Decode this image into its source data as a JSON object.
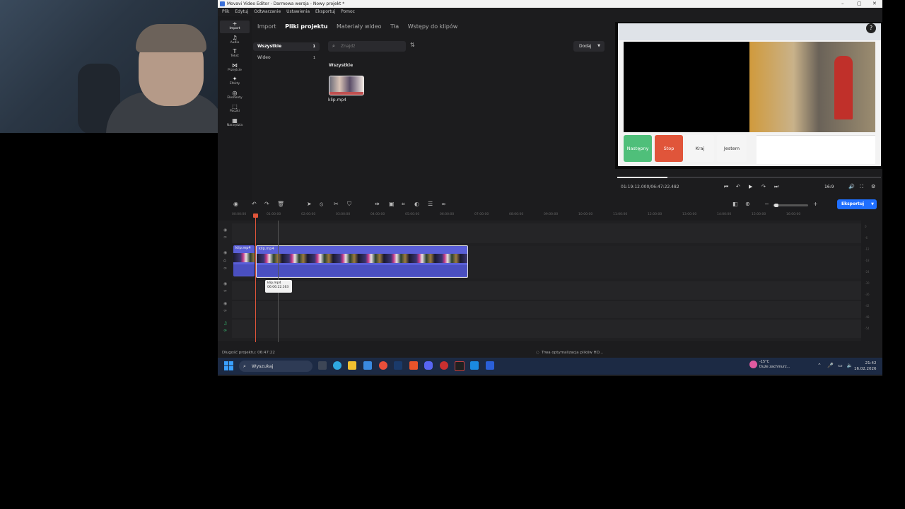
{
  "titlebar": {
    "title": "Movavi Video Editor - Darmowa wersja - Nowy projekt *",
    "minimize": "–",
    "maximize": "▢",
    "close": "✕"
  },
  "menu": [
    "Plik",
    "Edytuj",
    "Odtwarzanie",
    "Ustawienia",
    "Eksportuj",
    "Pomoc"
  ],
  "sidebar": {
    "items": [
      {
        "icon": "+",
        "label": "Import"
      },
      {
        "icon": "♫",
        "label": "Audio"
      },
      {
        "icon": "T",
        "label": "Tekst"
      },
      {
        "icon": "⋈",
        "label": "Przejście"
      },
      {
        "icon": "✦",
        "label": "Efekty"
      },
      {
        "icon": "◎",
        "label": "Elementy"
      },
      {
        "icon": "⬚",
        "label": "Paczki"
      },
      {
        "icon": "▦",
        "label": "Narzędzia"
      }
    ]
  },
  "tabs": [
    "Import",
    "Pliki projektu",
    "Materiały wideo",
    "Tła",
    "Wstępy do klipów"
  ],
  "categories": [
    {
      "label": "Wszystkie",
      "count": "1"
    },
    {
      "label": "Wideo",
      "count": "1"
    }
  ],
  "search": {
    "placeholder": "Znajdź"
  },
  "add_button": {
    "label": "Dodaj"
  },
  "media": {
    "group_label": "Wszystkie",
    "file_name": "klip.mp4"
  },
  "preview": {
    "buttons": [
      {
        "label": "Następny",
        "color": "#4fbf7a"
      },
      {
        "label": "Stop",
        "color": "#e0553a"
      },
      {
        "label": "Kraj",
        "color": "#f5f5f5"
      },
      {
        "label": "Jestem",
        "color": "#f5f5f5"
      }
    ],
    "timecode": "01:19:12.000/06:47:22.482",
    "aspect": "16:9",
    "progress_fraction": 0.19
  },
  "timeline": {
    "ruler": [
      "00:00:00",
      "01:00:00",
      "02:00:00",
      "03:00:00",
      "04:00:00",
      "05:00:00",
      "06:00:00",
      "07:00:00",
      "08:00:00",
      "09:00:00",
      "10:00:00",
      "11:00:00",
      "12:00:00",
      "13:00:00",
      "14:00:00",
      "15:00:00",
      "16:00:00"
    ],
    "clip1_label": "klip.mp4",
    "clip2_label": "klip.mp4",
    "tooltip_name": "klip.mp4",
    "tooltip_time": "06:06:22.163",
    "vu_labels": [
      "0",
      "-6",
      "-12",
      "-18",
      "-24",
      "-30",
      "-36",
      "-42",
      "-48",
      "-54"
    ],
    "export_label": "Eksportuj",
    "project_length": "Długość projektu: 06:47:22",
    "optimizing": "Trwa optymalizacja plików HD..."
  },
  "taskbar": {
    "search_label": "Wyszukaj",
    "weather_temp": "-15°C",
    "weather_desc": "Duże zachmurz...",
    "time": "21:42",
    "date": "16.02.2026"
  }
}
